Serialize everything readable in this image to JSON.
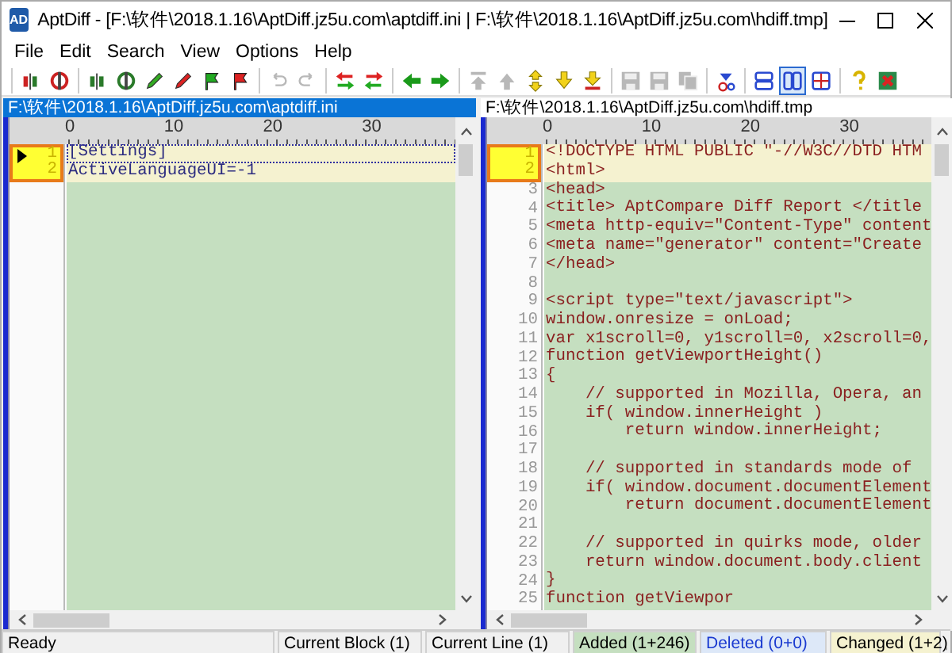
{
  "window": {
    "icon_text": "AD",
    "title": "AptDiff - [F:\\软件\\2018.1.16\\AptDiff.jz5u.com\\aptdiff.ini | F:\\软件\\2018.1.16\\AptDiff.jz5u.com\\hdiff.tmp]"
  },
  "menu": [
    "File",
    "Edit",
    "Search",
    "View",
    "Options",
    "Help"
  ],
  "toolbar": [
    [
      {
        "kind": "compare",
        "color": "#cc2222",
        "disabled": false
      },
      {
        "kind": "sync",
        "color": "#cc2222",
        "disabled": false
      }
    ],
    [
      {
        "kind": "compare",
        "color": "#2a7a2a",
        "disabled": false
      },
      {
        "kind": "sync",
        "color": "#2a7a2a",
        "disabled": false
      },
      {
        "kind": "pencil",
        "color": "#33aa22",
        "disabled": false
      },
      {
        "kind": "pencil",
        "color": "#dd2222",
        "disabled": false
      },
      {
        "kind": "flag",
        "color": "#22aa22",
        "disabled": false
      },
      {
        "kind": "flag",
        "color": "#dd2222",
        "disabled": false
      }
    ],
    [
      {
        "kind": "undo",
        "disabled": true
      },
      {
        "kind": "redo",
        "disabled": true
      }
    ],
    [
      {
        "kind": "swap-left",
        "disabled": false
      },
      {
        "kind": "swap-right",
        "disabled": false
      }
    ],
    [
      {
        "kind": "arrow-left",
        "disabled": false
      },
      {
        "kind": "arrow-right",
        "disabled": false
      }
    ],
    [
      {
        "kind": "first",
        "disabled": true
      },
      {
        "kind": "up",
        "disabled": true
      },
      {
        "kind": "updown",
        "disabled": false
      },
      {
        "kind": "down",
        "disabled": false
      },
      {
        "kind": "last",
        "disabled": false
      }
    ],
    [
      {
        "kind": "save",
        "disabled": true
      },
      {
        "kind": "save",
        "disabled": true
      },
      {
        "kind": "copy",
        "disabled": true
      }
    ],
    [
      {
        "kind": "go",
        "disabled": false
      }
    ],
    [
      {
        "kind": "layout-h",
        "disabled": false,
        "selected": false
      },
      {
        "kind": "layout-v",
        "disabled": false,
        "selected": true
      },
      {
        "kind": "layout-grid",
        "disabled": false,
        "selected": false
      }
    ],
    [
      {
        "kind": "help",
        "disabled": false
      },
      {
        "kind": "exit",
        "disabled": false
      }
    ]
  ],
  "panes": [
    {
      "path": "F:\\软件\\2018.1.16\\AptDiff.jz5u.com\\aptdiff.ini",
      "selected": true,
      "ruler": [
        "0",
        "10",
        "20",
        "30"
      ],
      "lines": [
        {
          "number": "1",
          "text": "[Settings]",
          "kind": "changed",
          "cursor": true
        },
        {
          "number": "2",
          "text": "ActiveLanguageUI=-1",
          "kind": "changed",
          "cursor": false
        }
      ]
    },
    {
      "path": "F:\\软件\\2018.1.16\\AptDiff.jz5u.com\\hdiff.tmp",
      "selected": false,
      "ruler": [
        "0",
        "10",
        "20",
        "30"
      ],
      "lines": [
        {
          "number": "1",
          "text": "<!DOCTYPE HTML PUBLIC \"-//W3C//DTD HTM",
          "kind": "changed",
          "cursor": false
        },
        {
          "number": "2",
          "text": "<html>",
          "kind": "changed",
          "cursor": false
        },
        {
          "number": "3",
          "text": "<head>",
          "kind": "added",
          "cursor": false
        },
        {
          "number": "4",
          "text": "<title> AptCompare Diff Report </title",
          "kind": "added",
          "cursor": false
        },
        {
          "number": "5",
          "text": "<meta http-equiv=\"Content-Type\" content",
          "kind": "added",
          "cursor": false
        },
        {
          "number": "6",
          "text": "<meta name=\"generator\" content=\"Create",
          "kind": "added",
          "cursor": false
        },
        {
          "number": "7",
          "text": "</head>",
          "kind": "added",
          "cursor": false
        },
        {
          "number": "8",
          "kind": "added",
          "cursor": false
        },
        {
          "number": "9",
          "text": "<script type=\"text/javascript\">",
          "kind": "added",
          "cursor": false
        },
        {
          "number": "10",
          "text": "window.onresize = onLoad;",
          "kind": "added",
          "cursor": false
        },
        {
          "number": "11",
          "text": "var x1scroll=0, y1scroll=0, x2scroll=0,",
          "kind": "added",
          "cursor": false
        },
        {
          "number": "12",
          "text": "function getViewportHeight()",
          "kind": "added",
          "cursor": false
        },
        {
          "number": "13",
          "text": "{",
          "kind": "added",
          "cursor": false
        },
        {
          "number": "14",
          "text": "    // supported in Mozilla, Opera, an",
          "kind": "added",
          "cursor": false
        },
        {
          "number": "15",
          "text": "    if( window.innerHeight )",
          "kind": "added",
          "cursor": false
        },
        {
          "number": "16",
          "text": "        return window.innerHeight;",
          "kind": "added",
          "cursor": false
        },
        {
          "number": "17",
          "kind": "added",
          "cursor": false
        },
        {
          "number": "18",
          "text": "    // supported in standards mode of",
          "kind": "added",
          "cursor": false
        },
        {
          "number": "19",
          "text": "    if( window.document.documentElement",
          "kind": "added",
          "cursor": false
        },
        {
          "number": "20",
          "text": "        return document.documentElement",
          "kind": "added",
          "cursor": false
        },
        {
          "number": "21",
          "kind": "added",
          "cursor": false
        },
        {
          "number": "22",
          "text": "    // supported in quirks mode, older",
          "kind": "added",
          "cursor": false
        },
        {
          "number": "23",
          "text": "    return window.document.body.client",
          "kind": "added",
          "cursor": false
        },
        {
          "number": "24",
          "text": "}",
          "kind": "added",
          "cursor": false
        },
        {
          "number": "25",
          "text": "function getViewpor",
          "kind": "added",
          "cursor": false
        }
      ]
    }
  ],
  "status_bar": [
    {
      "text": "Ready",
      "kind": "plain"
    },
    {
      "text": "Current Block  (1)",
      "kind": "plain"
    },
    {
      "text": "Current Line  (1)",
      "kind": "plain"
    },
    {
      "text": "Added (1+246)",
      "kind": "added"
    },
    {
      "text": "Deleted (0+0)",
      "kind": "deleted"
    },
    {
      "text": "Changed (1+2)",
      "kind": "changed"
    }
  ]
}
